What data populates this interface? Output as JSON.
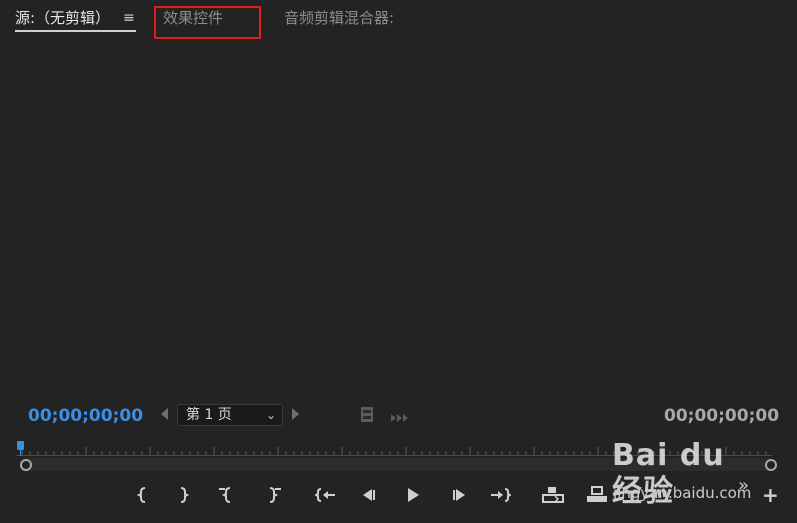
{
  "tabs": {
    "source_label": "源:（无剪辑）",
    "source_menu": "≡",
    "effects_label": "效果控件",
    "audio_mixer_label": "音频剪辑混合器:"
  },
  "transport": {
    "timecode_left": "00;00;00;00",
    "timecode_right": "00;00;00;00",
    "page_select": "第 1 页",
    "page_chevron": "⌄"
  },
  "toolbar": {
    "more": "»",
    "add": "+"
  },
  "watermark": {
    "brand": "Bai du 经验",
    "url": "jingyan.baidu.com"
  },
  "colors": {
    "accent_timecode": "#3b8ee6",
    "highlight_box": "#e01e1e",
    "panel_bg": "#232323"
  }
}
